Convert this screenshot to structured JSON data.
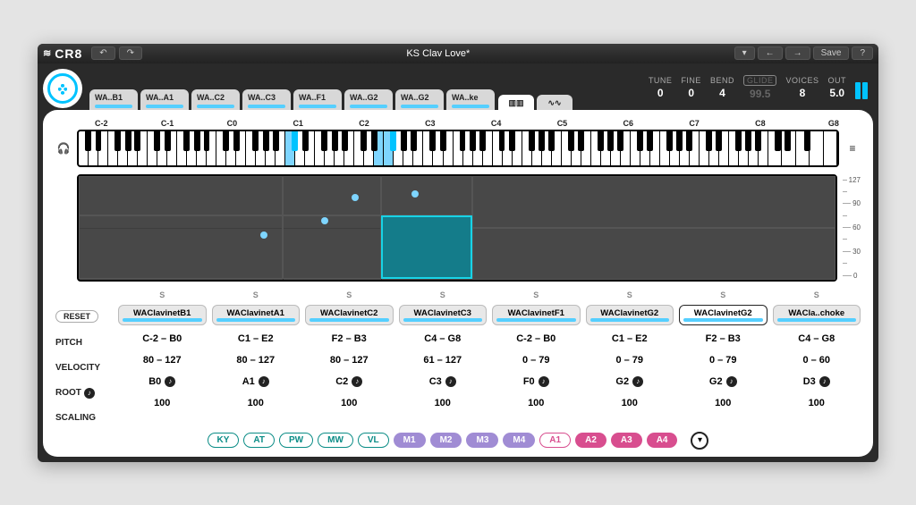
{
  "app": {
    "name": "CR8"
  },
  "titlebar": {
    "undo": "↶",
    "redo": "↷",
    "preset": "KS Clav Love*",
    "menu": "▾",
    "prev": "←",
    "next": "→",
    "save": "Save",
    "help": "?"
  },
  "tabs": [
    {
      "label": "WA..B1"
    },
    {
      "label": "WA..A1"
    },
    {
      "label": "WA..C2"
    },
    {
      "label": "WA..C3"
    },
    {
      "label": "WA..F1"
    },
    {
      "label": "WA..G2"
    },
    {
      "label": "WA..G2"
    },
    {
      "label": "WA..ke"
    }
  ],
  "header_params": {
    "tune": {
      "label": "TUNE",
      "value": "0"
    },
    "fine": {
      "label": "FINE",
      "value": "0"
    },
    "bend": {
      "label": "BEND",
      "value": "4"
    },
    "glide": {
      "label": "GLIDE",
      "value": "99.5"
    },
    "voices": {
      "label": "VOICES",
      "value": "8"
    },
    "out": {
      "label": "OUT",
      "value": "5.0"
    }
  },
  "octaves": [
    "C-2",
    "C-1",
    "C0",
    "C1",
    "C2",
    "C3",
    "C4",
    "C5",
    "C6",
    "C7",
    "C8",
    "G8"
  ],
  "vel_ticks": [
    "127",
    "90",
    "60",
    "30",
    "0"
  ],
  "row_labels": {
    "reset": "RESET",
    "pitch": "PITCH",
    "velocity": "VELOCITY",
    "root": "ROOT",
    "scaling": "SCALING"
  },
  "samples": [
    {
      "s": "S",
      "name": "WAClavinetB1",
      "pitch": "C-2 – B0",
      "velocity": "80 – 127",
      "root": "B0",
      "scaling": "100"
    },
    {
      "s": "S",
      "name": "WAClavinetA1",
      "pitch": "C1 – E2",
      "velocity": "80 – 127",
      "root": "A1",
      "scaling": "100"
    },
    {
      "s": "S",
      "name": "WAClavinetC2",
      "pitch": "F2 – B3",
      "velocity": "80 – 127",
      "root": "C2",
      "scaling": "100"
    },
    {
      "s": "S",
      "name": "WAClavinetC3",
      "pitch": "C4 – G8",
      "velocity": "61 – 127",
      "root": "C3",
      "scaling": "100"
    },
    {
      "s": "S",
      "name": "WAClavinetF1",
      "pitch": "C-2 – B0",
      "velocity": "0 – 79",
      "root": "F0",
      "scaling": "100"
    },
    {
      "s": "S",
      "name": "WAClavinetG2",
      "pitch": "C1 – E2",
      "velocity": "0 – 79",
      "root": "G2",
      "scaling": "100"
    },
    {
      "s": "S",
      "name": "WAClavinetG2",
      "pitch": "F2 – B3",
      "velocity": "0 – 79",
      "root": "G2",
      "scaling": "100",
      "selected": true
    },
    {
      "s": "S",
      "name": "WACla..choke",
      "pitch": "C4 – G8",
      "velocity": "0 – 60",
      "root": "D3",
      "scaling": "100"
    }
  ],
  "mods": {
    "group1": [
      "KY",
      "AT",
      "PW",
      "MW",
      "VL"
    ],
    "group2": [
      "M1",
      "M2",
      "M3",
      "M4"
    ],
    "group3": [
      "A1",
      "A2",
      "A3",
      "A4"
    ],
    "active": "A1"
  }
}
